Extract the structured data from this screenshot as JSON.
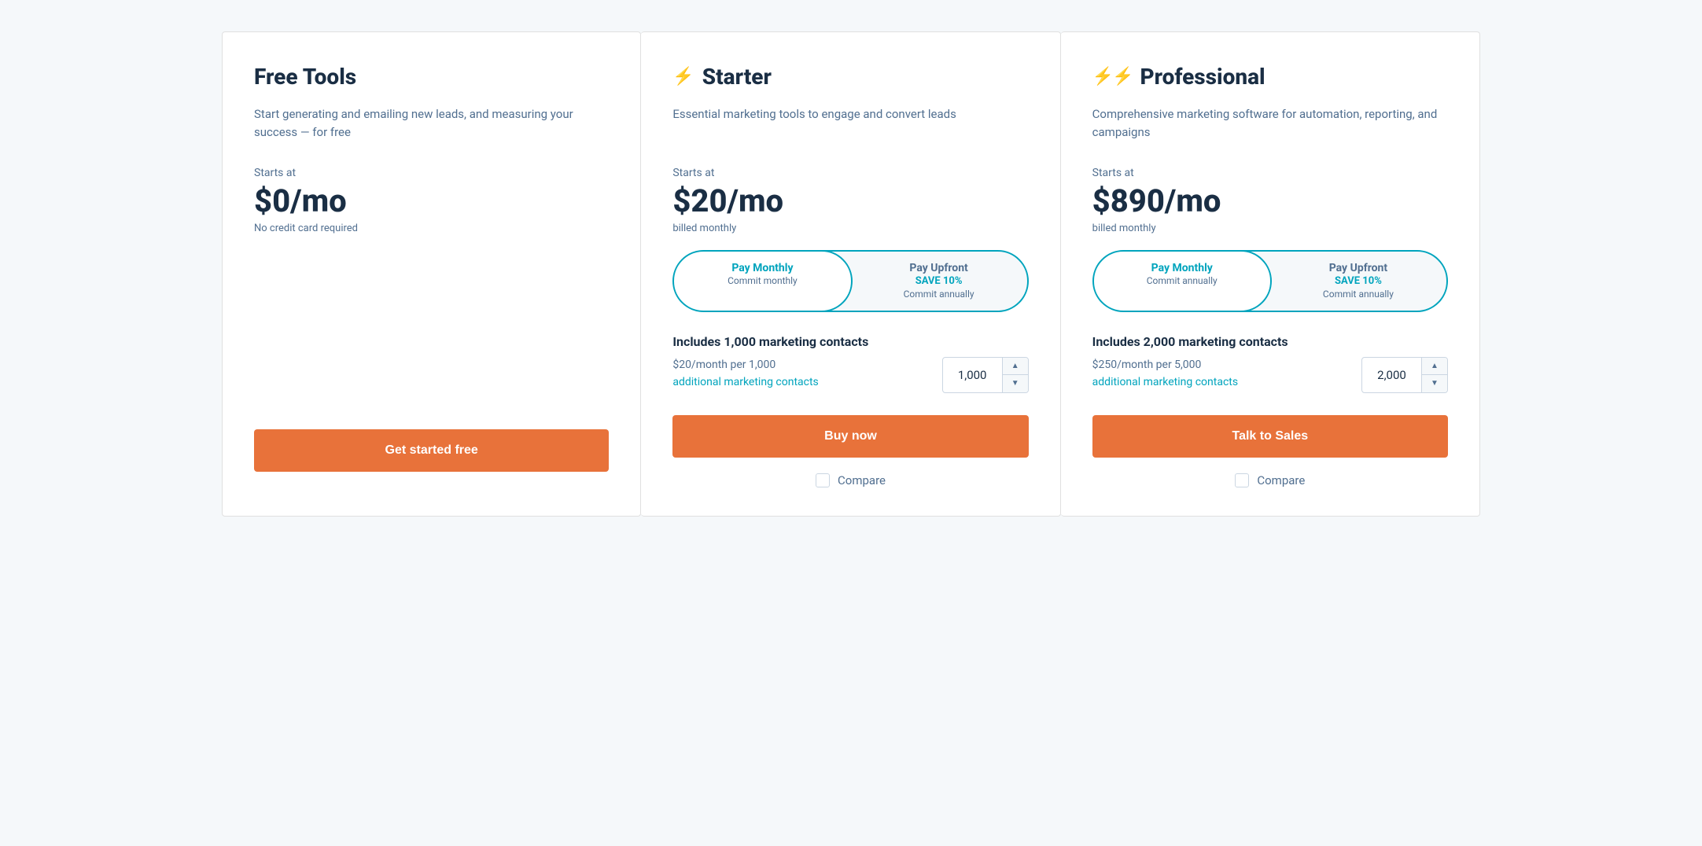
{
  "cards": [
    {
      "id": "free",
      "title": "Free Tools",
      "icon": null,
      "description": "Start generating and emailing new leads, and measuring your success — for free",
      "price_label": "Starts at",
      "price": "$0/mo",
      "price_note": "No credit card required",
      "billing": null,
      "toggle": null,
      "contacts": null,
      "cta_label": "Get started free",
      "compare_label": null,
      "has_compare": false
    },
    {
      "id": "starter",
      "title": "Starter",
      "icon": "single-bolt",
      "description": "Essential marketing tools to engage and convert leads",
      "price_label": "Starts at",
      "price": "$20/mo",
      "billing": "billed monthly",
      "price_note": null,
      "toggle": {
        "option1": {
          "title": "Pay Monthly",
          "subtitle": "Commit monthly",
          "active": true
        },
        "option2": {
          "title": "Pay Upfront",
          "save": "SAVE 10%",
          "subtitle": "Commit annually",
          "active": false
        }
      },
      "contacts": {
        "title": "Includes 1,000 marketing contacts",
        "price_per": "$20/month per 1,000",
        "link_text": "additional marketing contacts",
        "value": "1,000"
      },
      "cta_label": "Buy now",
      "compare_label": "Compare",
      "has_compare": true
    },
    {
      "id": "professional",
      "title": "Professional",
      "icon": "double-bolt",
      "description": "Comprehensive marketing software for automation, reporting, and campaigns",
      "price_label": "Starts at",
      "price": "$890/mo",
      "billing": "billed monthly",
      "price_note": null,
      "toggle": {
        "option1": {
          "title": "Pay Monthly",
          "subtitle": "Commit annually",
          "active": true
        },
        "option2": {
          "title": "Pay Upfront",
          "save": "SAVE 10%",
          "subtitle": "Commit annually",
          "active": false
        }
      },
      "contacts": {
        "title": "Includes 2,000 marketing contacts",
        "price_per": "$250/month per 5,000",
        "link_text": "additional marketing contacts",
        "value": "2,000"
      },
      "cta_label": "Talk to Sales",
      "compare_label": "Compare",
      "has_compare": true
    }
  ],
  "icons": {
    "single_bolt": "⚡",
    "double_bolt": "⚡⚡",
    "chevron_up": "▲",
    "chevron_down": "▼"
  }
}
